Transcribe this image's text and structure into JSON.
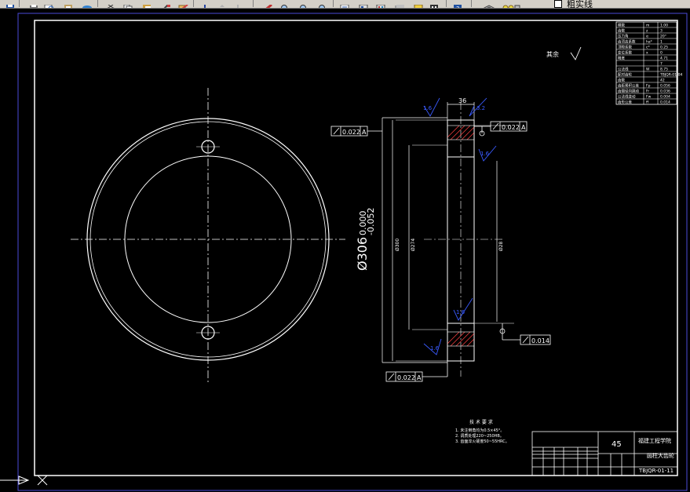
{
  "toolbar": {
    "layer_name": "粗实线",
    "icons": [
      "save-icon",
      "print-icon",
      "preview-icon",
      "publish-icon",
      "plot-icon",
      "cut-icon",
      "copy-icon",
      "paste-icon",
      "matchprop-icon",
      "blockedit-icon",
      "undo-icon",
      "redo-icon",
      "pan-icon",
      "zoom-realtime-icon",
      "zoom-window-icon",
      "zoom-previous-icon",
      "properties-icon",
      "designcenter-icon",
      "toolpalette-icon",
      "sheetset-icon",
      "markup-icon",
      "calculator-icon",
      "help-icon",
      "layer-manager-icon",
      "layer-state-icon"
    ]
  },
  "drawing": {
    "diameter_main": "Ø306",
    "tol_upper": "0.000",
    "tol_lower": "-0.052",
    "width_dim": "36",
    "gdt_runout_1": "0.022",
    "gdt_ref_1": "A",
    "gdt_runout_2": "0.022",
    "gdt_ref_2": "A",
    "gdt_runout_3": "0.022",
    "gdt_ref_3": "A",
    "gdt_flatness": "0.014",
    "bore_dim": "Ø28",
    "inner_dim_1": "Ø300",
    "inner_dim_2": "Ø274",
    "roughness_a": "1.6",
    "roughness_b": "3.2",
    "roughness_c": "1.6",
    "roughness_d": "1.6",
    "roughness_e": "1.6",
    "roughness_other": "其余"
  },
  "params_table": [
    [
      "模数",
      "m",
      "1.00"
    ],
    [
      "齿数",
      "z",
      "3"
    ],
    [
      "压力角",
      "α",
      "20°"
    ],
    [
      "齿顶高系数",
      "ha*",
      "1"
    ],
    [
      "顶隙系数",
      "c*",
      "0.25"
    ],
    [
      "变位系数",
      "x",
      "0"
    ],
    [
      "精度",
      "",
      "4.71"
    ],
    [
      "",
      "",
      "7"
    ],
    [
      "公法线",
      "W",
      "8.75"
    ],
    [
      "配对齿轮",
      "",
      "TBJQR-01-04"
    ],
    [
      "齿数",
      "",
      "42"
    ],
    [
      "齿距累积公差",
      "Fp",
      "0.056"
    ],
    [
      "齿圈径向跳动",
      "Fr",
      "0.036"
    ],
    [
      "公法线变动",
      "Fw",
      "0.004"
    ],
    [
      "齿形公差",
      "ff",
      "0.014"
    ]
  ],
  "tech_requirements": {
    "title": "技 术 要 求",
    "items": [
      "1. 未注倒角均为0.5×45°。",
      "2. 调质处理220~250HB。",
      "3. 齿面淬火硬度50~55HRC。"
    ]
  },
  "title_block": {
    "material": "45",
    "school": "福建工程学院",
    "part_name": "圆柱大齿轮",
    "drawing_no": "TBJQR-01-11"
  }
}
